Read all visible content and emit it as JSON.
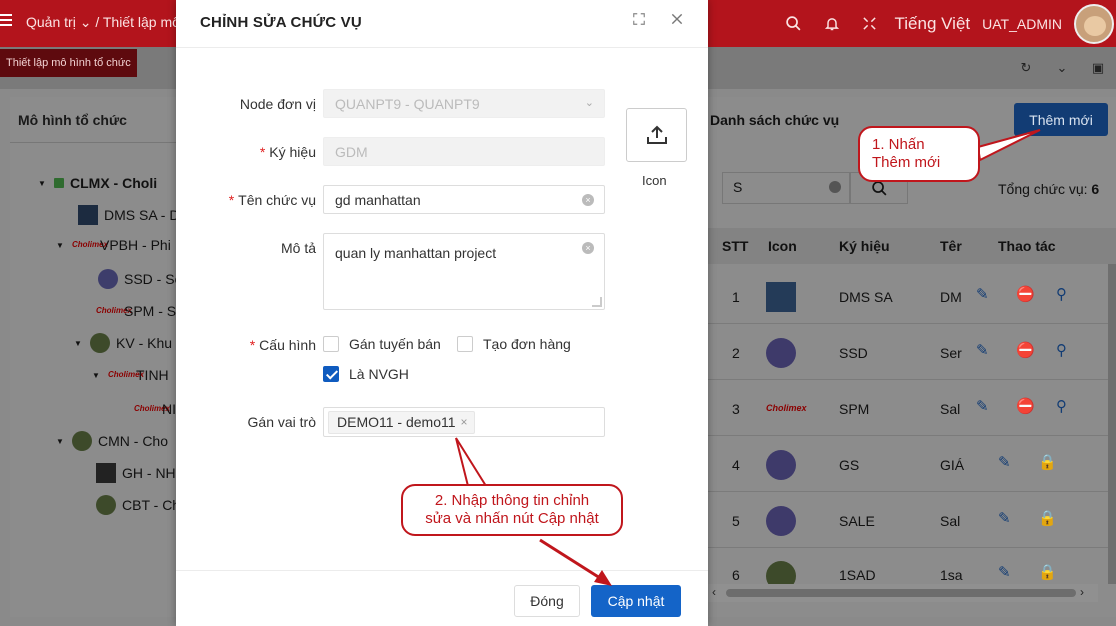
{
  "topbar": {
    "breadcrumb_1": "Quản trị",
    "breadcrumb_2": "Thiết lập mô hì",
    "language": "Tiếng Việt",
    "username": "UAT_ADMIN"
  },
  "subbar": {
    "tab_label": "Thiết lập mô hình tổ chức"
  },
  "left_panel": {
    "title": "Mô hình tổ chức",
    "tree": [
      {
        "label": "CLMX - Choli"
      },
      {
        "label": "DMS SA - D"
      },
      {
        "label": "VPBH - Phi"
      },
      {
        "label": "SSD - Se"
      },
      {
        "label": "SPM - S"
      },
      {
        "label": "KV - Khu"
      },
      {
        "label": "TINH"
      },
      {
        "label": "NI"
      },
      {
        "label": "CMN - Cho"
      },
      {
        "label": "GH - NH"
      },
      {
        "label": "CBT - Ch"
      }
    ]
  },
  "right_panel": {
    "title": "Danh sách chức vụ",
    "add_button": "Thêm mới",
    "search_value": "S",
    "total_label": "Tổng chức vụ:",
    "total_value": "6",
    "columns": [
      "STT",
      "Icon",
      "Ký hiệu",
      "Têr",
      "Thao tác"
    ],
    "rows": [
      {
        "stt": "1",
        "code": "DMS SA",
        "name": "DM"
      },
      {
        "stt": "2",
        "code": "SSD",
        "name": "Ser"
      },
      {
        "stt": "3",
        "code": "SPM",
        "name": "Sal"
      },
      {
        "stt": "4",
        "code": "GS",
        "name": "GIÁ"
      },
      {
        "stt": "5",
        "code": "SALE",
        "name": "Sal"
      },
      {
        "stt": "6",
        "code": "1SAD",
        "name": "1sa"
      }
    ]
  },
  "modal": {
    "title": "CHỈNH SỬA CHỨC VỤ",
    "node_label": "Node đơn vị",
    "node_value": "QUANPT9 - QUANPT9",
    "code_label": "Ký hiệu",
    "code_placeholder": "GDM",
    "name_label": "Tên chức vụ",
    "name_value": "gd manhattan",
    "desc_label": "Mô tả",
    "desc_value": "quan ly manhattan project",
    "config_label": "Cấu hình",
    "config_options": [
      {
        "label": "Gán tuyến bán",
        "checked": false
      },
      {
        "label": "Tạo đơn hàng",
        "checked": false
      },
      {
        "label": "Là NVGH",
        "checked": true
      }
    ],
    "role_label": "Gán vai trò",
    "role_tag": "DEMO11 - demo11",
    "icon_label": "Icon",
    "close_button": "Đóng",
    "update_button": "Cập nhật"
  },
  "callouts": {
    "step1_line1": "1. Nhấn",
    "step1_line2": "Thêm mới",
    "step2_line1": "2. Nhập thông tin chỉnh",
    "step2_line2": "sửa và nhấn nút Cập nhật"
  },
  "colors": {
    "brand_red": "#b3141c",
    "primary_blue": "#1464c8",
    "callout_red": "#c0161c"
  }
}
